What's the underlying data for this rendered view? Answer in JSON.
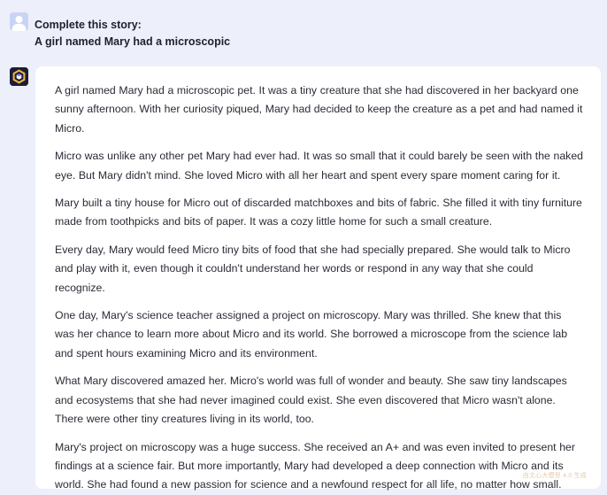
{
  "user_message": {
    "line1": "Complete this story:",
    "line2": "A girl named Mary had a microscopic"
  },
  "assistant_message": {
    "paragraphs": [
      "A girl named Mary had a microscopic pet. It was a tiny creature that she had discovered in her backyard one sunny afternoon. With her curiosity piqued, Mary had decided to keep the creature as a pet and had named it Micro.",
      "Micro was unlike any other pet Mary had ever had. It was so small that it could barely be seen with the naked eye. But Mary didn't mind. She loved Micro with all her heart and spent every spare moment caring for it.",
      "Mary built a tiny house for Micro out of discarded matchboxes and bits of fabric. She filled it with tiny furniture made from toothpicks and bits of paper. It was a cozy little home for such a small creature.",
      "Every day, Mary would feed Micro tiny bits of food that she had specially prepared. She would talk to Micro and play with it, even though it couldn't understand her words or respond in any way that she could recognize.",
      "One day, Mary's science teacher assigned a project on microscopy. Mary was thrilled. She knew that this was her chance to learn more about Micro and its world. She borrowed a microscope from the science lab and spent hours examining Micro and its environment.",
      "What Mary discovered amazed her. Micro's world was full of wonder and beauty. She saw tiny landscapes and ecosystems that she had never imagined could exist. She even discovered that Micro wasn't alone. There were other tiny creatures living in its world, too.",
      "Mary's project on microscopy was a huge success. She received an A+ and was even invited to present her findings at a science fair. But more importantly, Mary had developed a deep connection with Micro and its world. She had found a new passion for science and a newfound respect for all life, no matter how small."
    ],
    "watermark": "由文心大模型 4.0 生成"
  },
  "icons": {
    "user_avatar": "user-avatar-icon",
    "bot_avatar": "assistant-logo-icon"
  },
  "colors": {
    "background": "#edeffa",
    "bubble": "#ffffff",
    "user_avatar_bg": "#c9d4f5",
    "bot_avatar_bg": "#1c1d3a",
    "watermark": "#e9c9a6"
  }
}
